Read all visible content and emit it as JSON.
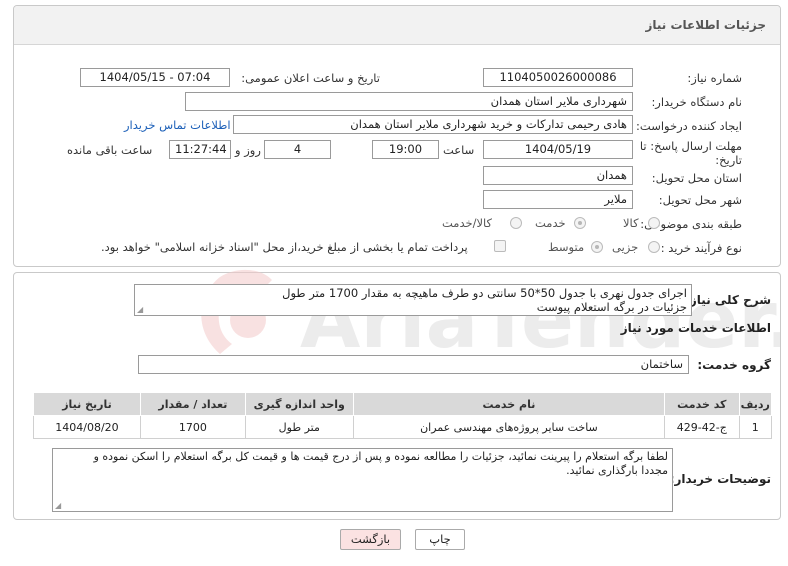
{
  "header": {
    "title": "جزئیات اطلاعات نیاز"
  },
  "form": {
    "need_number": {
      "label": "شماره نیاز:",
      "value": "1104050026000086"
    },
    "announce_datetime": {
      "label": "تاریخ و ساعت اعلان عمومی:",
      "value": "1404/05/15 - 07:04"
    },
    "buyer_org": {
      "label": "نام دستگاه خریدار:",
      "value": "شهرداری ملایر استان همدان"
    },
    "requester": {
      "label": "ایجاد کننده درخواست:",
      "value": "هادی رحیمی تدارکات و خرید شهرداری ملایر استان همدان"
    },
    "contact_link": "اطلاعات تماس خریدار",
    "deadline": {
      "label_line1": "مهلت ارسال پاسخ: تا",
      "label_line2": "تاریخ:",
      "date": "1404/05/19",
      "time_label": "ساعت",
      "time": "19:00",
      "days": "4",
      "days_label": "روز و",
      "remaining": "11:27:44",
      "remaining_label": "ساعت باقی مانده"
    },
    "province": {
      "label": "استان محل تحویل:",
      "value": "همدان"
    },
    "city": {
      "label": "شهر محل تحویل:",
      "value": "ملایر"
    },
    "category": {
      "label": "طبقه بندی موضوعی:",
      "options": [
        "کالا",
        "خدمت",
        "کالا/خدمت"
      ],
      "selected": "خدمت"
    },
    "process": {
      "label": "نوع فرآیند خرید :",
      "options": [
        "جزیی",
        "متوسط"
      ],
      "selected": "متوسط",
      "payment_note": "پرداخت تمام یا بخشی از مبلغ خرید،از محل \"اسناد خزانه اسلامی\" خواهد بود."
    }
  },
  "summary": {
    "label": "شرح کلی نیاز:",
    "text_line1": "اجرای جدول نهری با جدول 50*50 سانتی دو طرف ماهیچه به مقدار 1700 متر طول",
    "text_line2": "جزئیات در برگه استعلام پیوست"
  },
  "services": {
    "heading": "اطلاعات خدمات مورد نیاز",
    "group_label": "گروه خدمت:",
    "group_value": "ساختمان",
    "columns": [
      "ردیف",
      "کد خدمت",
      "نام خدمت",
      "واحد اندازه گیری",
      "تعداد / مقدار",
      "تاریخ نیاز"
    ],
    "rows": [
      [
        "1",
        "ج-42-429",
        "ساخت سایر پروژه‌های مهندسی عمران",
        "متر طول",
        "1700",
        "1404/08/20"
      ]
    ]
  },
  "buyer_notes": {
    "label": "توضیحات خریدار:",
    "text_line1": "لطفا برگه استعلام را پیرینت نمائید، جزئیات را مطالعه نموده و پس از درج قیمت ها و قیمت کل برگه استعلام را اسکن نموده و",
    "text_line2": "مجددا بارگذاری نمائید."
  },
  "buttons": {
    "print": "چاپ",
    "back": "بازگشت"
  },
  "watermark": {
    "text": "AriaTender.net"
  }
}
